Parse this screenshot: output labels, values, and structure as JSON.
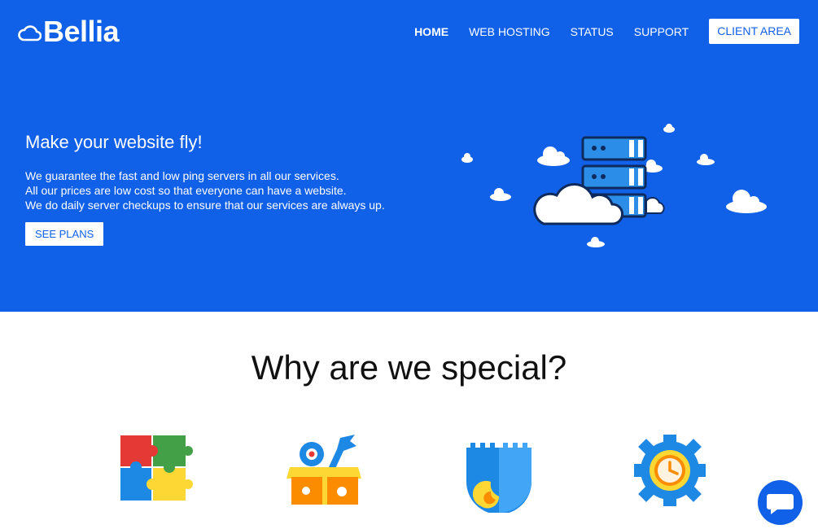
{
  "brand": {
    "name": "Bellia",
    "logo_icon": "cloud-icon"
  },
  "nav": {
    "items": [
      {
        "label": "HOME",
        "active": true
      },
      {
        "label": "WEB HOSTING",
        "active": false
      },
      {
        "label": "STATUS",
        "active": false
      },
      {
        "label": "SUPPORT",
        "active": false
      }
    ],
    "client_area_label": "CLIENT AREA"
  },
  "hero": {
    "title": "Make your website fly!",
    "lines": [
      "We guarantee the fast and low ping servers in all our services.",
      "All our prices are low cost so that everyone can have a website.",
      "We do daily server checkups to ensure that our services are always up."
    ],
    "button_label": "SEE PLANS",
    "illustration_icon": "server-clouds-icon"
  },
  "features": {
    "title": "Why are we special?",
    "icons": [
      "puzzle-icon",
      "toolbox-icon",
      "shield-flame-icon",
      "gear-clock-icon"
    ]
  },
  "chat": {
    "icon": "chat-bubble-icon"
  },
  "colors": {
    "primary": "#1160e8",
    "white": "#ffffff",
    "text_dark": "#111111"
  }
}
